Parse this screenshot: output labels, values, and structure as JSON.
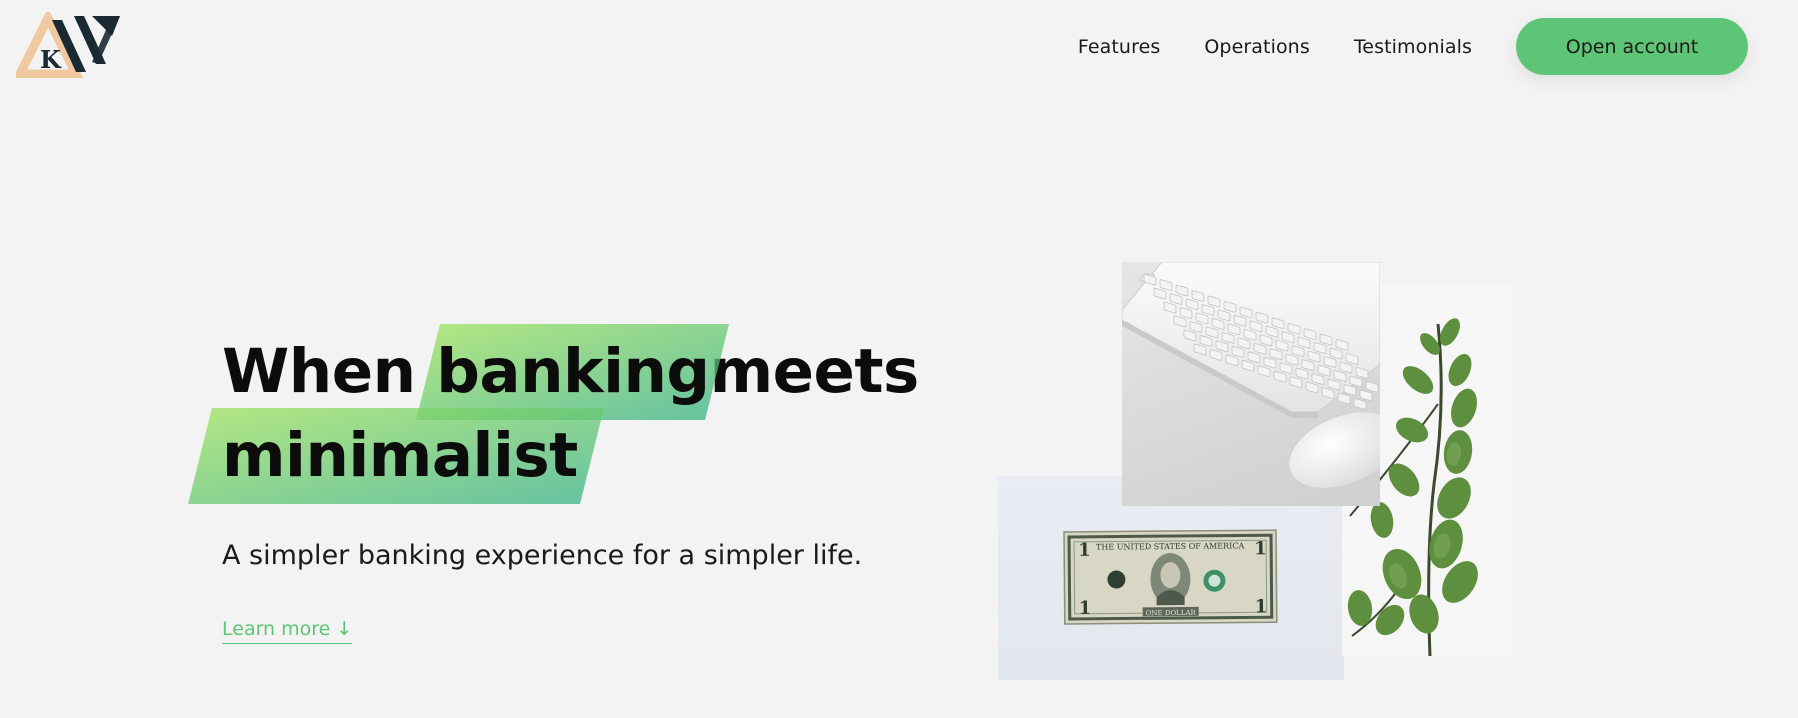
{
  "brand": {
    "logo_letter": "K",
    "logo_colors": {
      "triangle": "#f0c9a0",
      "mark": "#1a2a33"
    }
  },
  "nav": {
    "links": [
      "Features",
      "Operations",
      "Testimonials"
    ],
    "cta": "Open account"
  },
  "hero": {
    "title_word1": "When",
    "title_highlight1": "banking",
    "title_word2": "meets",
    "title_highlight2": "minimalist",
    "subtitle": "A simpler banking experience for a simpler life.",
    "learn_more": "Learn more ↓"
  },
  "colors": {
    "accent": "#5ec576",
    "gradient_from": "#9be15d",
    "gradient_to": "#39b385",
    "background": "#f3f3f3"
  },
  "illustration": {
    "items": [
      "keyboard-and-mouse-image",
      "dollar-bill-image",
      "plant-image"
    ],
    "dollar_text": "THE UNITED STATES OF AMERICA",
    "dollar_bottom": "ONE DOLLAR"
  }
}
